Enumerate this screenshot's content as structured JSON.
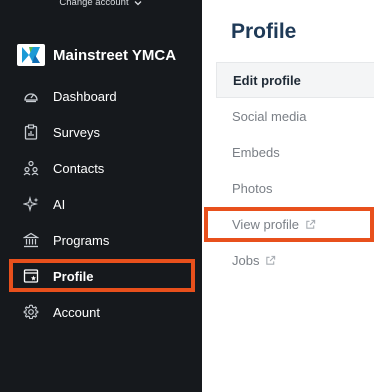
{
  "sidebar": {
    "change_account_label": "Change account",
    "org_name": "Mainstreet YMCA",
    "items": [
      {
        "label": "Dashboard",
        "icon": "gauge-icon"
      },
      {
        "label": "Surveys",
        "icon": "clipboard-chart-icon"
      },
      {
        "label": "Contacts",
        "icon": "people-icon"
      },
      {
        "label": "AI",
        "icon": "sparkle-icon"
      },
      {
        "label": "Programs",
        "icon": "institution-icon"
      },
      {
        "label": "Profile",
        "icon": "profile-star-icon",
        "active": true
      },
      {
        "label": "Account",
        "icon": "gear-icon"
      }
    ]
  },
  "main": {
    "title": "Profile",
    "submenu": [
      {
        "label": "Edit profile",
        "active": true
      },
      {
        "label": "Social media"
      },
      {
        "label": "Embeds"
      },
      {
        "label": "Photos"
      },
      {
        "label": "View profile",
        "external": true
      },
      {
        "label": "Jobs",
        "external": true
      }
    ]
  },
  "colors": {
    "sidebar_bg": "#16191d",
    "highlight": "#e8501c",
    "title": "#1f3a57"
  }
}
